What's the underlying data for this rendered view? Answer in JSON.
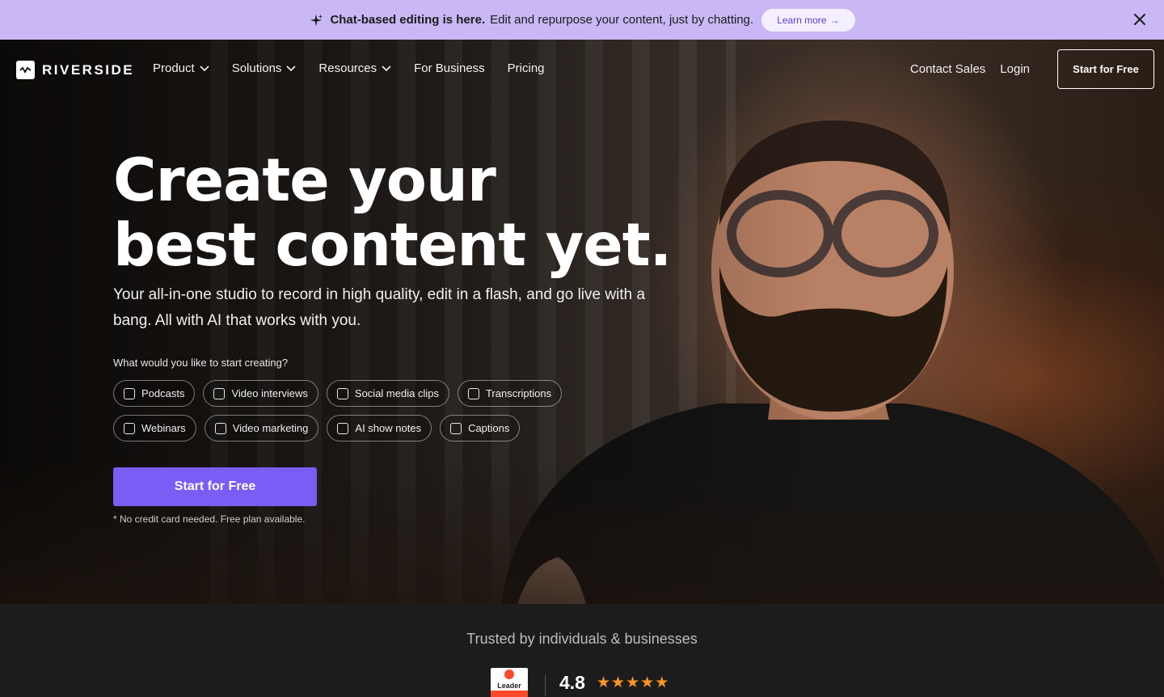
{
  "announcement": {
    "bold_text": "Chat-based editing is here.",
    "text": "Edit and repurpose your content, just by chatting.",
    "learn_more": "Learn more",
    "bg_color": "#c9b8f5"
  },
  "nav": {
    "logo": "RIVERSIDE",
    "links": [
      {
        "label": "Product",
        "has_dropdown": true
      },
      {
        "label": "Solutions",
        "has_dropdown": true
      },
      {
        "label": "Resources",
        "has_dropdown": true
      },
      {
        "label": "For Business",
        "has_dropdown": false
      },
      {
        "label": "Pricing",
        "has_dropdown": false
      }
    ],
    "contact_sales": "Contact Sales",
    "login": "Login",
    "cta": "Start for Free"
  },
  "hero": {
    "headline_line1": "Create your",
    "headline_line2": "best content yet.",
    "subheadline": "Your all-in-one studio to record in high quality, edit in a flash, and go live with a bang. All with AI that works with you.",
    "prompt": "What would you like to start creating?",
    "chips_row1": [
      "Podcasts",
      "Video interviews",
      "Social media clips",
      "Transcriptions"
    ],
    "chips_row2": [
      "Webinars",
      "Video marketing",
      "AI show notes",
      "Captions"
    ],
    "cta": "Start for Free",
    "cta_color": "#7b5cf5",
    "note": "* No credit card needed. Free plan available."
  },
  "trusted": {
    "title": "Trusted by individuals & businesses",
    "badge_label": "Leader",
    "rating": "4.8",
    "stars": 5,
    "star_color": "#ff9326"
  }
}
